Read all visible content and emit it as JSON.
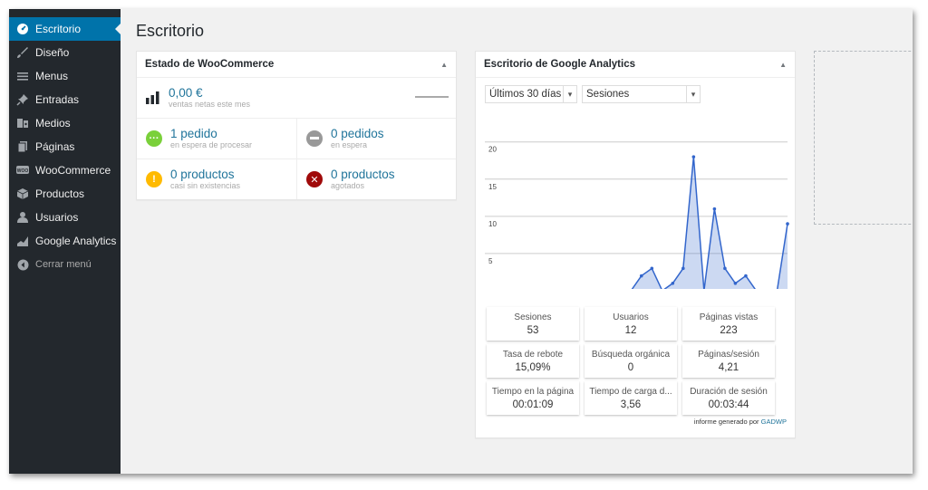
{
  "sidebar": {
    "items": [
      {
        "label": "Escritorio",
        "icon": "dashboard-icon",
        "active": true
      },
      {
        "label": "Diseño",
        "icon": "brush-icon"
      },
      {
        "label": "Menus",
        "icon": "menu-icon"
      },
      {
        "label": "Entradas",
        "icon": "pin-icon"
      },
      {
        "label": "Medios",
        "icon": "media-icon"
      },
      {
        "label": "Páginas",
        "icon": "pages-icon"
      },
      {
        "label": "WooCommerce",
        "icon": "woocommerce-icon"
      },
      {
        "label": "Productos",
        "icon": "products-icon"
      },
      {
        "label": "Usuarios",
        "icon": "users-icon"
      },
      {
        "label": "Google Analytics",
        "icon": "analytics-icon"
      }
    ],
    "collapse": {
      "label": "Cerrar menú",
      "icon": "collapse-icon"
    }
  },
  "page_title": "Escritorio",
  "woocommerce": {
    "title": "Estado de WooCommerce",
    "sales": {
      "value": "0,00 €",
      "caption": "ventas netas este mes"
    },
    "cells": [
      {
        "value": "1 pedido",
        "caption": "en espera de procesar",
        "color": "#7ad03a",
        "icon": "processing-icon"
      },
      {
        "value": "0 pedidos",
        "caption": "en espera",
        "color": "#999999",
        "icon": "on-hold-icon"
      },
      {
        "value": "0 productos",
        "caption": "casi sin existencias",
        "color": "#ffba00",
        "icon": "warning-icon"
      },
      {
        "value": "0 productos",
        "caption": "agotados",
        "color": "#a00a0a",
        "icon": "out-of-stock-icon"
      }
    ]
  },
  "analytics": {
    "title": "Escritorio de Google Analytics",
    "period": "Últimos 30 días",
    "metric": "Sesiones",
    "stats": [
      {
        "label": "Sesiones",
        "value": "53"
      },
      {
        "label": "Usuarios",
        "value": "12"
      },
      {
        "label": "Páginas vistas",
        "value": "223"
      },
      {
        "label": "Tasa de rebote",
        "value": "15,09%"
      },
      {
        "label": "Búsqueda orgánica",
        "value": "0"
      },
      {
        "label": "Páginas/sesión",
        "value": "4,21"
      },
      {
        "label": "Tiempo en la página",
        "value": "00:01:09"
      },
      {
        "label": "Tiempo de carga d...",
        "value": "3,56"
      },
      {
        "label": "Duración de sesión",
        "value": "00:03:44"
      }
    ],
    "footer_text": "informe generado por",
    "footer_link": "GADWP"
  },
  "chart_data": {
    "type": "area",
    "x": [
      1,
      2,
      3,
      4,
      5,
      6,
      7,
      8,
      8,
      9,
      10,
      11,
      12,
      13,
      14,
      15,
      16,
      17,
      18,
      19,
      20,
      21,
      22,
      23,
      24,
      25,
      26,
      27,
      28,
      29,
      30
    ],
    "values": [
      0,
      0,
      0,
      0,
      0,
      0,
      0,
      0,
      0,
      0,
      0,
      0,
      0,
      0,
      0,
      2,
      3,
      0,
      1,
      3,
      18,
      0,
      11,
      3,
      1,
      2,
      0,
      0,
      0,
      9
    ],
    "y_ticks": [
      5,
      10,
      15,
      20
    ],
    "ylim": [
      0,
      21
    ],
    "grid": true,
    "color": "#3366cc"
  }
}
